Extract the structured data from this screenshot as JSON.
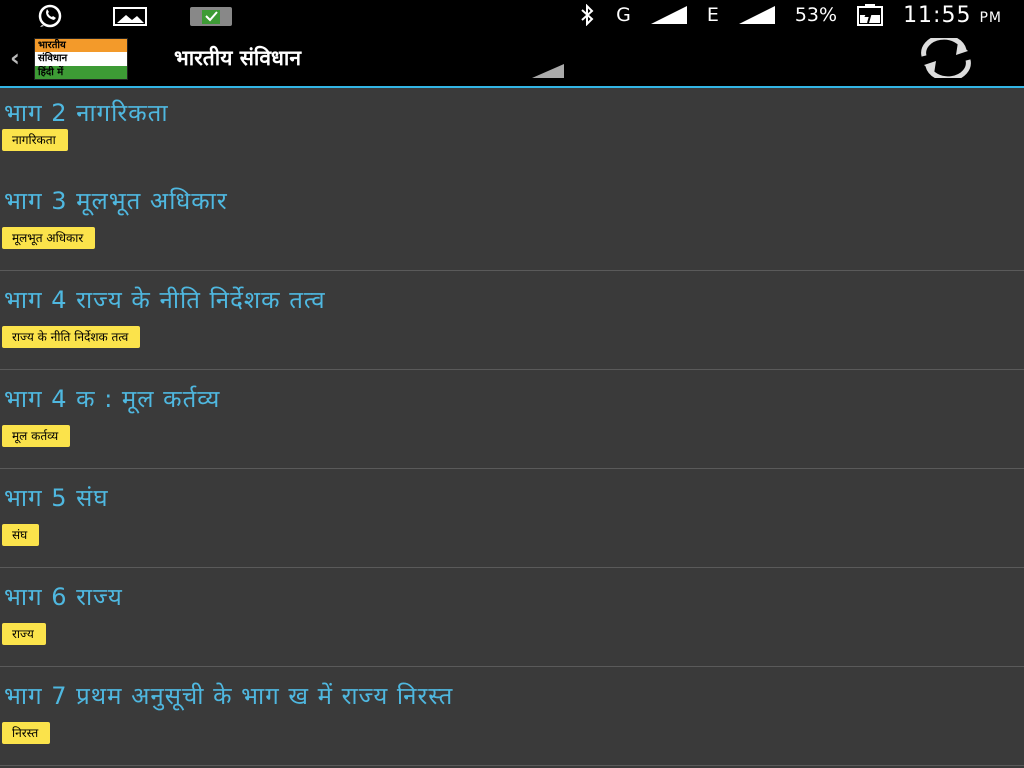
{
  "status_bar": {
    "battery": "53%",
    "time": "11:55",
    "ampm": "PM",
    "network_1": "G",
    "network_2": "E",
    "icons": [
      "whatsapp-icon",
      "image-icon",
      "store-icon",
      "bluetooth-icon",
      "signal-icon",
      "battery-icon"
    ]
  },
  "action_bar": {
    "logo_lines": [
      "भारतीय",
      "संविधान",
      "हिंदी में"
    ],
    "title": "भारतीय संविधान",
    "accent_color": "#33b5e5"
  },
  "list": [
    {
      "title": "भाग 2 नागरिकता",
      "tag": "नागरिकता"
    },
    {
      "title": "भाग 3 मूलभूत अधिकार",
      "tag": "मूलभूत अधिकार"
    },
    {
      "title": "भाग 4 राज्य के नीति निर्देशक तत्व",
      "tag": "राज्य के नीति निर्देशक तत्व"
    },
    {
      "title": "भाग 4 क : मूल कर्तव्य",
      "tag": "मूल कर्तव्य"
    },
    {
      "title": "भाग 5 संघ",
      "tag": "संघ"
    },
    {
      "title": "भाग 6 राज्य",
      "tag": "राज्य"
    },
    {
      "title": "भाग 7 प्रथम अनुसूची के भाग ख में राज्य निरस्त",
      "tag": "निरस्त"
    }
  ],
  "colors": {
    "title_text": "#4fb8e0",
    "tag_background": "#fbe34b",
    "list_background": "#3a3a3a"
  }
}
